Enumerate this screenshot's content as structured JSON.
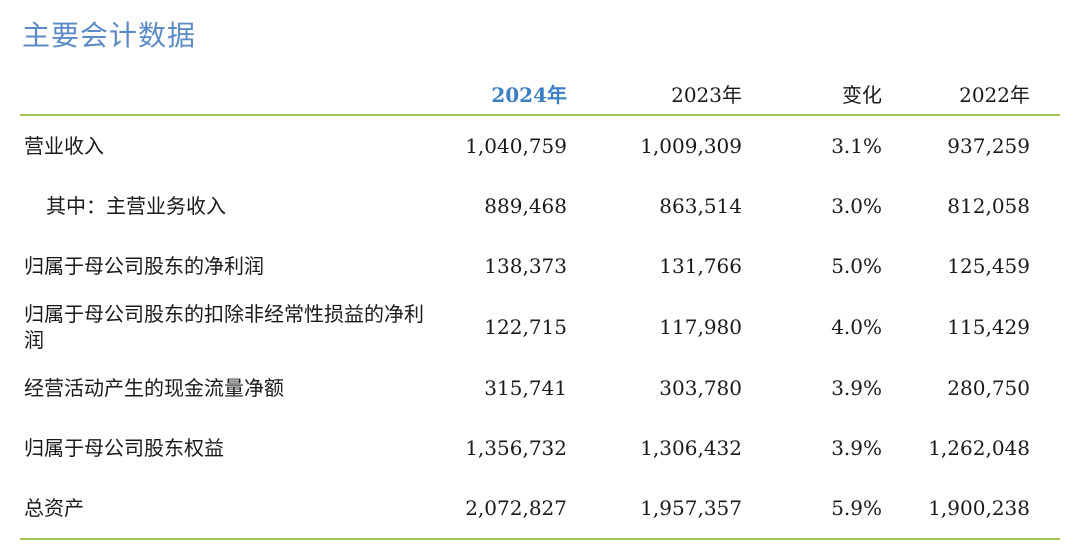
{
  "title": "主要会计数据",
  "header": {
    "col1": "2024年",
    "col2": "2023年",
    "col3": "变化",
    "col4": "2022年"
  },
  "colors": {
    "title": "#5b8bc6",
    "highlight_year": "#3c7fc4",
    "rule": "#9fc552"
  },
  "rows": [
    {
      "label": "营业收入",
      "v2024": "1,040,759",
      "v2023": "1,009,309",
      "change": "3.1%",
      "v2022": "937,259"
    },
    {
      "label": "其中：主营业务收入",
      "v2024": "889,468",
      "v2023": "863,514",
      "change": "3.0%",
      "v2022": "812,058"
    },
    {
      "label": "归属于母公司股东的净利润",
      "v2024": "138,373",
      "v2023": "131,766",
      "change": "5.0%",
      "v2022": "125,459"
    },
    {
      "label": "归属于母公司股东的扣除非经常性损益的净利润",
      "v2024": "122,715",
      "v2023": "117,980",
      "change": "4.0%",
      "v2022": "115,429"
    },
    {
      "label": "经营活动产生的现金流量净额",
      "v2024": "315,741",
      "v2023": "303,780",
      "change": "3.9%",
      "v2022": "280,750"
    },
    {
      "label": "归属于母公司股东权益",
      "v2024": "1,356,732",
      "v2023": "1,306,432",
      "change": "3.9%",
      "v2022": "1,262,048"
    },
    {
      "label": "总资产",
      "v2024": "2,072,827",
      "v2023": "1,957,357",
      "change": "5.9%",
      "v2022": "1,900,238"
    }
  ]
}
